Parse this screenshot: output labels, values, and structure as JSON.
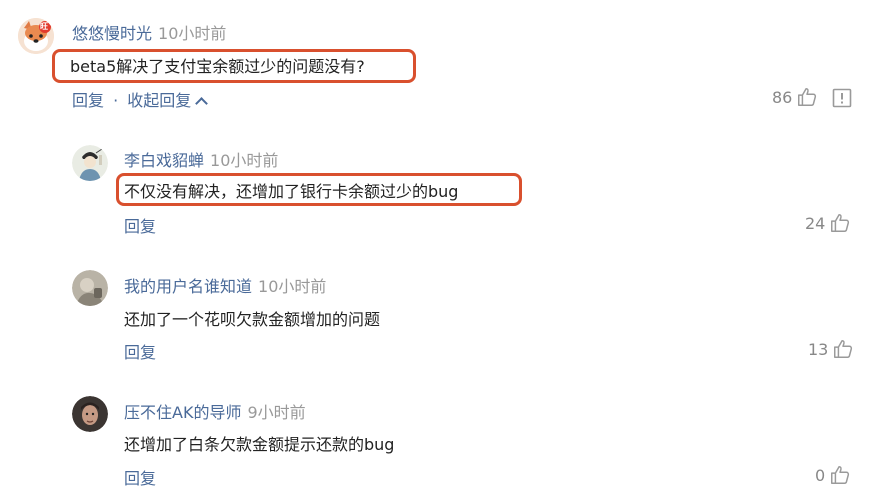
{
  "comments": [
    {
      "author": "悠悠慢时光",
      "time": "10小时前",
      "text": "beta5解决了支付宝余额过少的问题没有?",
      "reply_label": "回复",
      "separator": "·",
      "collapse_label": "收起回复",
      "likes": "86",
      "avatar_badge": "旺"
    },
    {
      "author": "李白戏貂蝉",
      "time": "10小时前",
      "text": "不仅没有解决，还增加了银行卡余额过少的bug",
      "reply_label": "回复",
      "likes": "24"
    },
    {
      "author": "我的用户名谁知道",
      "time": "10小时前",
      "text": "还加了一个花呗欠款金额增加的问题",
      "reply_label": "回复",
      "likes": "13"
    },
    {
      "author": "压不住AK的导师",
      "time": "9小时前",
      "text": "还增加了白条欠款金额提示还款的bug",
      "reply_label": "回复",
      "likes": "0"
    }
  ],
  "colors": {
    "link": "#4a6a99",
    "highlight_box": "#d9502e",
    "muted": "#999999"
  },
  "icons": [
    "thumbs-up-icon",
    "report-icon",
    "chevron-up-icon"
  ]
}
